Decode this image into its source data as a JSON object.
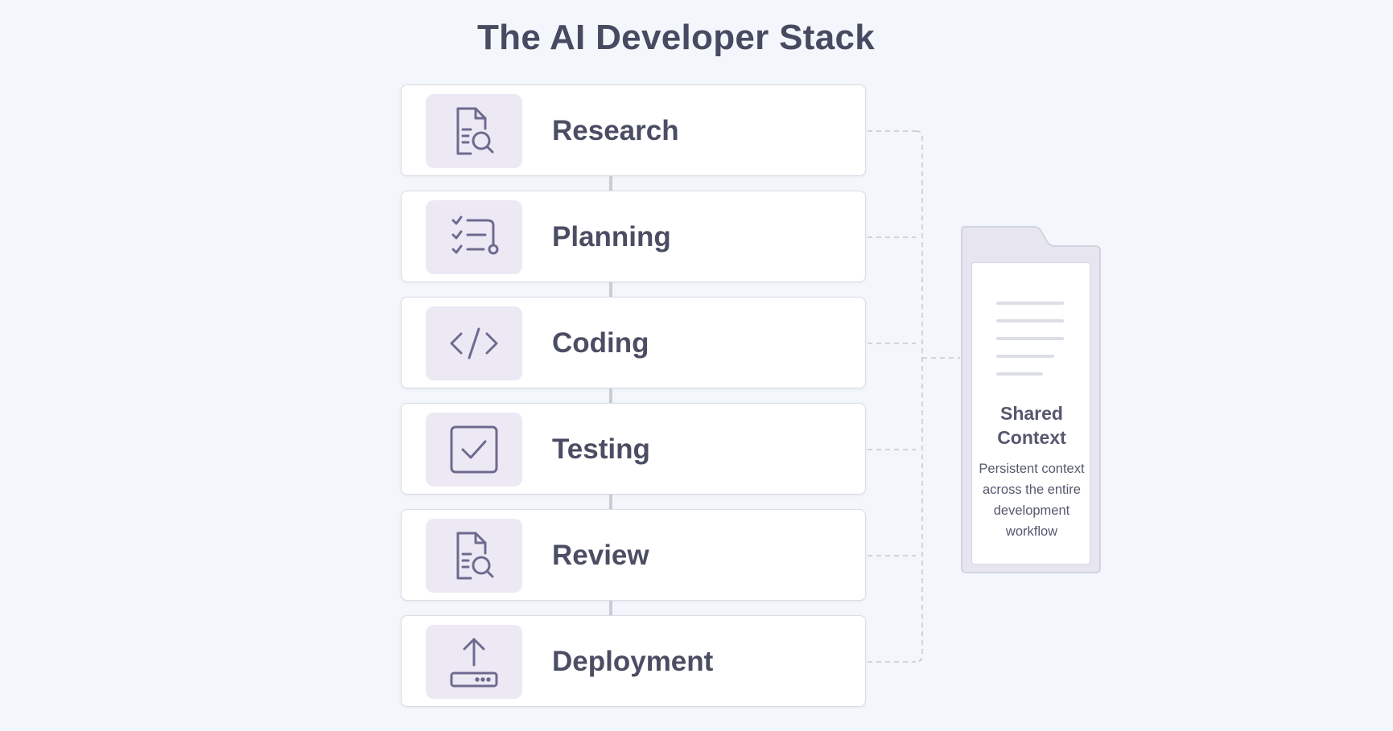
{
  "title": "The AI Developer Stack",
  "stages": [
    {
      "label": "Research",
      "icon": "document-search-icon"
    },
    {
      "label": "Planning",
      "icon": "checklist-icon"
    },
    {
      "label": "Coding",
      "icon": "code-brackets-icon"
    },
    {
      "label": "Testing",
      "icon": "checkbox-icon"
    },
    {
      "label": "Review",
      "icon": "document-search-icon"
    },
    {
      "label": "Deployment",
      "icon": "upload-server-icon"
    }
  ],
  "shared_context": {
    "title": "Shared Context",
    "description": "Persistent context across the entire development workflow",
    "icon": "folder-document-icon"
  },
  "colors": {
    "background": "#f3f6fa",
    "icon_stroke": "#6e6a8f",
    "icon_bg": "#ece9f5",
    "text": "#4a4d63",
    "dash": "#c9ccd8"
  }
}
